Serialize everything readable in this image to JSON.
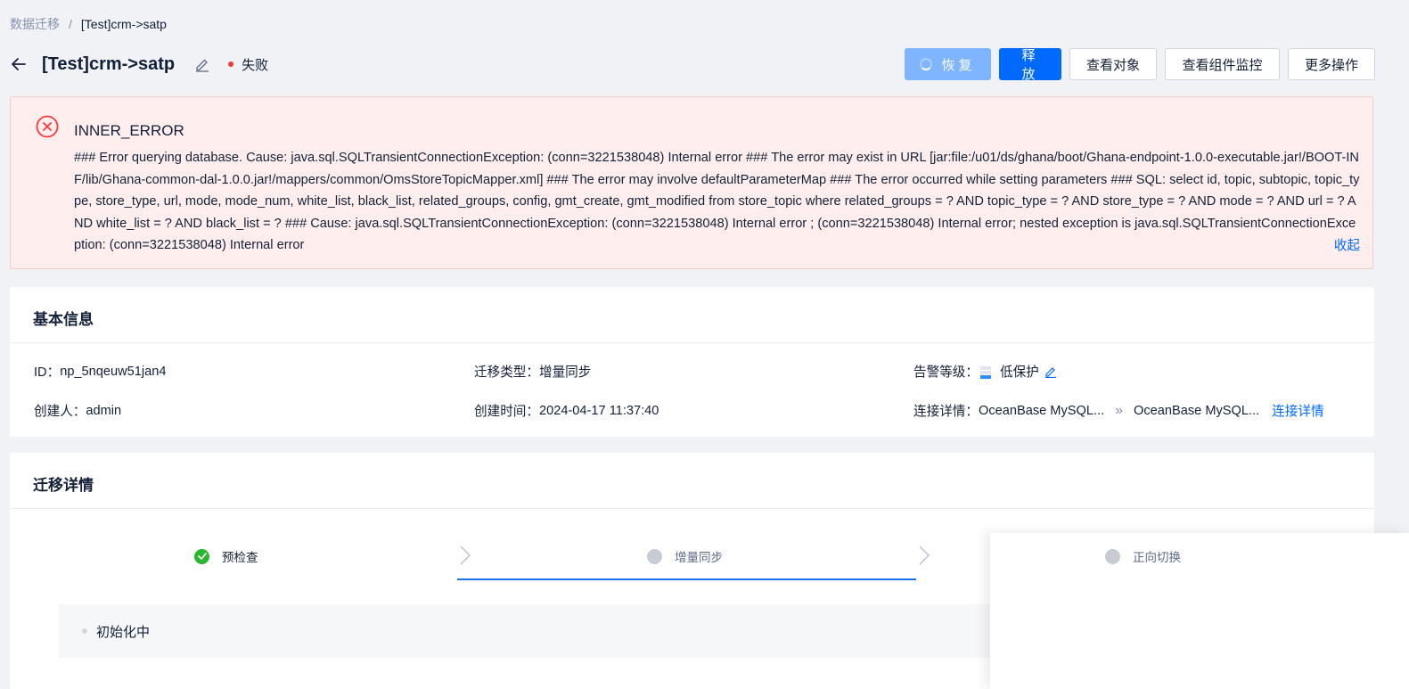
{
  "breadcrumb": {
    "parent": "数据迁移",
    "separator": "/",
    "current": "[Test]crm->satp"
  },
  "header": {
    "title": "[Test]crm->satp",
    "status": "失败",
    "actions": {
      "resume": "恢复",
      "release": "释放",
      "view_objects": "查看对象",
      "view_monitor": "查看组件监控",
      "more": "更多操作"
    }
  },
  "alert": {
    "title": "INNER_ERROR",
    "message": "### Error querying database. Cause: java.sql.SQLTransientConnectionException: (conn=3221538048) Internal error ### The error may exist in URL [jar:file:/u01/ds/ghana/boot/Ghana-endpoint-1.0.0-executable.jar!/BOOT-INF/lib/Ghana-common-dal-1.0.0.jar!/mappers/common/OmsStoreTopicMapper.xml] ### The error may involve defaultParameterMap ### The error occurred while setting parameters ### SQL: select id, topic, subtopic, topic_type, store_type, url, mode, mode_num, white_list, black_list, related_groups, config, gmt_create, gmt_modified from store_topic where related_groups = ? AND topic_type = ? AND store_type = ? AND mode = ? AND url = ? AND white_list = ? AND black_list = ? ### Cause: java.sql.SQLTransientConnectionException: (conn=3221538048) Internal error ; (conn=3221538048) Internal error; nested exception is java.sql.SQLTransientConnectionException: (conn=3221538048) Internal error",
    "collapse": "收起"
  },
  "basic_info": {
    "title": "基本信息",
    "id_label": "ID：",
    "id_value": "np_5nqeuw51jan4",
    "type_label": "迁移类型：",
    "type_value": "增量同步",
    "alarm_label": "告警等级：",
    "alarm_value": "低保护",
    "alarm_level": 1,
    "creator_label": "创建人：",
    "creator_value": "admin",
    "created_label": "创建时间：",
    "created_value": "2024-04-17 11:37:40",
    "conn_label": "连接详情：",
    "conn_source": "OceanBase MySQL...",
    "conn_arrow": "»",
    "conn_target": "OceanBase MySQL...",
    "conn_link": "连接详情"
  },
  "migration_detail": {
    "title": "迁移详情",
    "steps": [
      {
        "label": "预检查",
        "state": "done"
      },
      {
        "label": "增量同步",
        "state": "pending"
      },
      {
        "label": "正向切换",
        "state": "pending"
      }
    ],
    "sub_status": "初始化中"
  },
  "colors": {
    "primary": "#006aff",
    "error": "#f93939",
    "success": "#29b631",
    "background": "#f0f2f5"
  }
}
